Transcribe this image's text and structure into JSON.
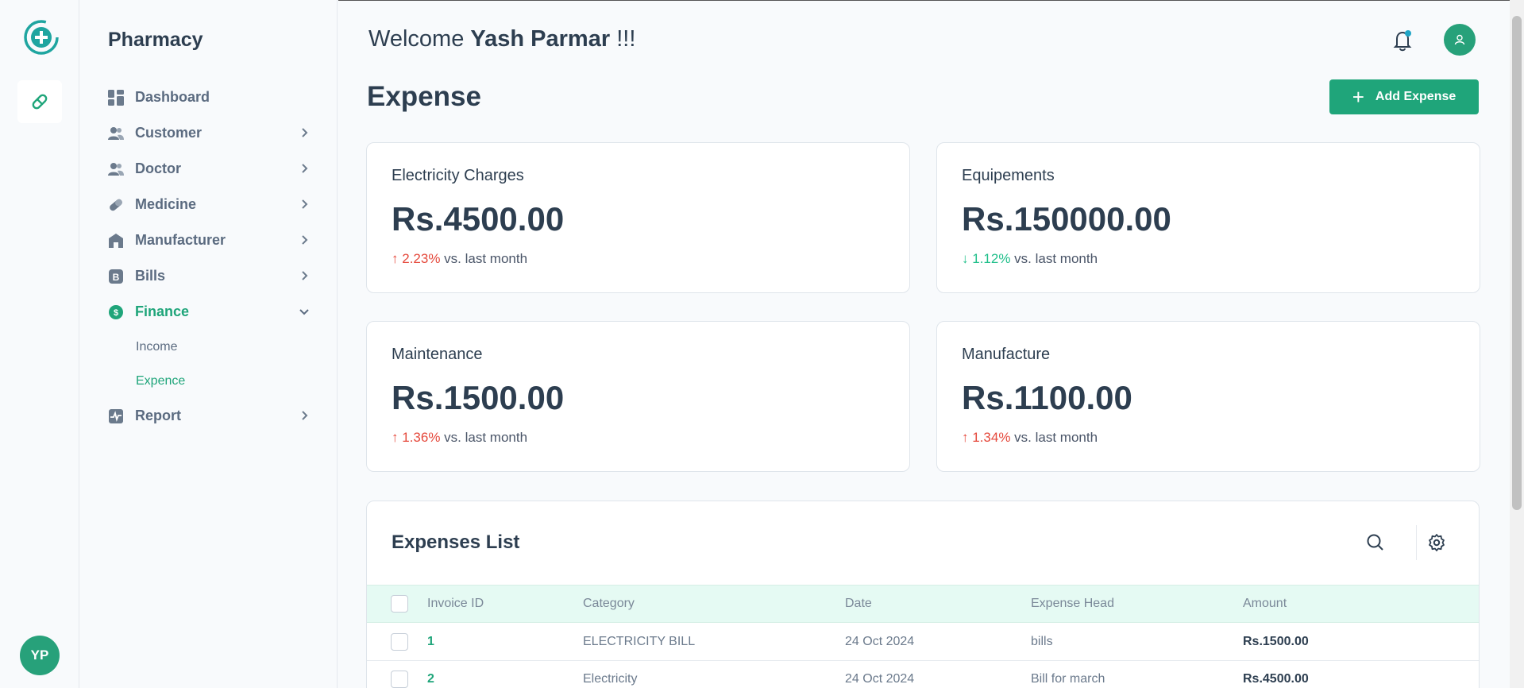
{
  "app": {
    "brand": "Pharmacy",
    "user_initials": "YP"
  },
  "sidebar": {
    "items": [
      {
        "label": "Dashboard",
        "icon": "dashboard-icon",
        "has_chevron": false
      },
      {
        "label": "Customer",
        "icon": "users-icon",
        "has_chevron": true
      },
      {
        "label": "Doctor",
        "icon": "users-icon",
        "has_chevron": true
      },
      {
        "label": "Medicine",
        "icon": "pill-icon",
        "has_chevron": true
      },
      {
        "label": "Manufacturer",
        "icon": "building-icon",
        "has_chevron": true
      },
      {
        "label": "Bills",
        "icon": "bills-icon",
        "has_chevron": true
      },
      {
        "label": "Finance",
        "icon": "dollar-icon",
        "has_chevron": true,
        "expanded": true
      },
      {
        "label": "Report",
        "icon": "activity-icon",
        "has_chevron": true
      }
    ],
    "finance_sub": [
      "Income",
      "Expence"
    ],
    "active_sub": "Expence"
  },
  "header": {
    "welcome_prefix": "Welcome",
    "user_name": "Yash Parmar",
    "welcome_suffix": "!!!"
  },
  "page": {
    "title": "Expense",
    "add_button": "Add Expense"
  },
  "cards": [
    {
      "label": "Electricity Charges",
      "value": "Rs.4500.00",
      "trend": "up",
      "arrow": "↑",
      "delta": "2.23%",
      "suffix": "vs. last month"
    },
    {
      "label": "Equipements",
      "value": "Rs.150000.00",
      "trend": "down",
      "arrow": "↓",
      "delta": "1.12%",
      "suffix": "vs. last month"
    },
    {
      "label": "Maintenance",
      "value": "Rs.1500.00",
      "trend": "up",
      "arrow": "↑",
      "delta": "1.36%",
      "suffix": "vs. last month"
    },
    {
      "label": "Manufacture",
      "value": "Rs.1100.00",
      "trend": "up",
      "arrow": "↑",
      "delta": "1.34%",
      "suffix": "vs. last month"
    }
  ],
  "table": {
    "title": "Expenses List",
    "columns": [
      "Invoice ID",
      "Category",
      "Date",
      "Expense Head",
      "Amount"
    ],
    "rows": [
      [
        "1",
        "ELECTRICITY BILL",
        "24 Oct 2024",
        "bills",
        "Rs.1500.00"
      ],
      [
        "2",
        "Electricity",
        "24 Oct 2024",
        "Bill for march",
        "Rs.4500.00"
      ]
    ]
  },
  "colors": {
    "accent": "#1fa57a",
    "up": "#e5483b",
    "down": "#1fbf8a",
    "text": "#2d3e50"
  }
}
